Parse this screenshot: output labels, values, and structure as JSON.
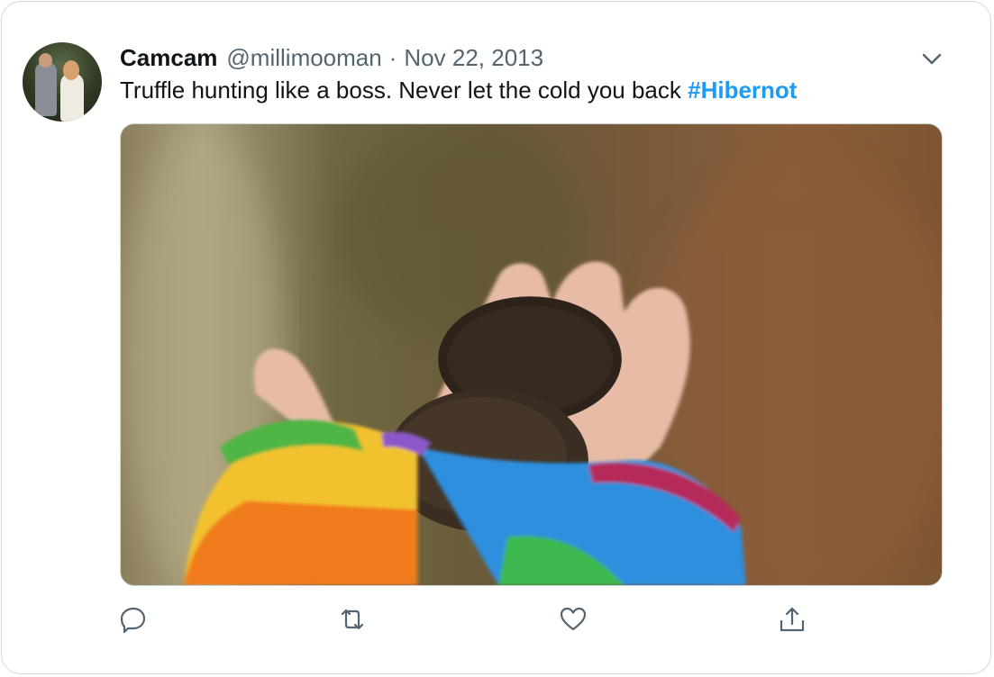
{
  "tweet": {
    "author_name": "Camcam",
    "handle": "@millimooman",
    "separator": "·",
    "date": "Nov 22, 2013",
    "text": "Truffle hunting like a boss. Never let the cold you back ",
    "hashtag": "#Hibernot"
  },
  "icons": {
    "more": "chevron-down-icon",
    "reply": "reply-icon",
    "retweet": "retweet-icon",
    "like": "heart-icon",
    "share": "share-icon"
  },
  "colors": {
    "text": "#0f1419",
    "secondary": "#536471",
    "link": "#1d9bf0",
    "border": "#cfd9de"
  }
}
